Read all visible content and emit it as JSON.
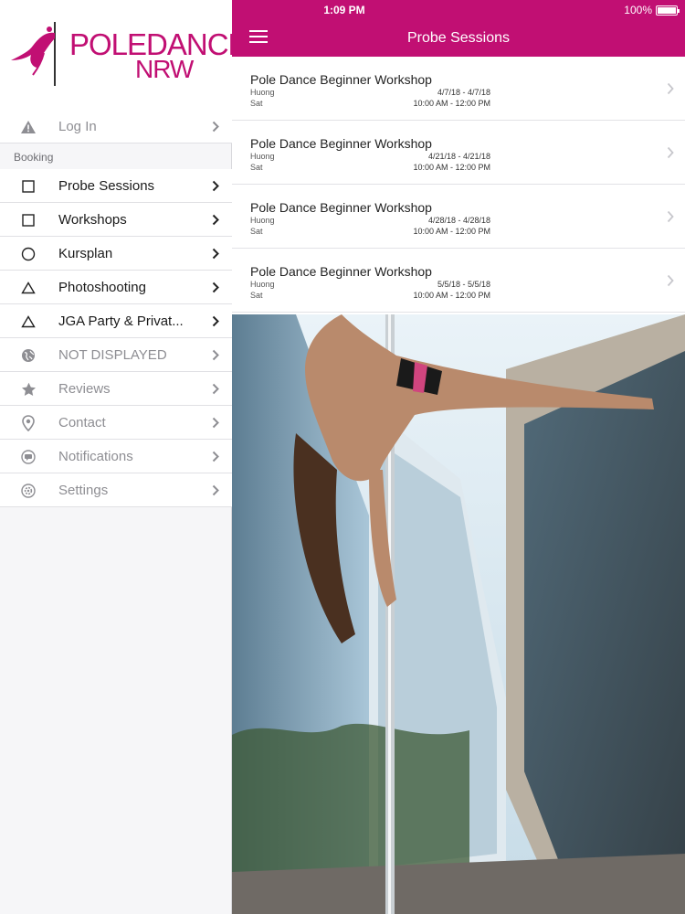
{
  "status_bar": {
    "time": "1:09 PM",
    "battery": "100%"
  },
  "header": {
    "title": "Probe Sessions"
  },
  "logo": {
    "line1": "POLEDANCE",
    "line2": "NRW"
  },
  "sidebar": {
    "section_booking": "Booking",
    "items": [
      {
        "label": "Log In",
        "icon": "warning-icon",
        "muted": true
      },
      {
        "label": "Probe Sessions",
        "icon": "square-icon",
        "muted": false
      },
      {
        "label": "Workshops",
        "icon": "square-icon",
        "muted": false
      },
      {
        "label": "Kursplan",
        "icon": "circle-icon",
        "muted": false
      },
      {
        "label": "Photoshooting",
        "icon": "triangle-icon",
        "muted": false
      },
      {
        "label": "JGA Party & Privat...",
        "icon": "triangle-icon",
        "muted": false
      },
      {
        "label": "NOT DISPLAYED",
        "icon": "globe-icon",
        "muted": true
      },
      {
        "label": "Reviews",
        "icon": "star-icon",
        "muted": true
      },
      {
        "label": "Contact",
        "icon": "location-pin-icon",
        "muted": true
      },
      {
        "label": "Notifications",
        "icon": "chat-bubble-icon",
        "muted": true
      },
      {
        "label": "Settings",
        "icon": "gear-icon",
        "muted": true
      }
    ]
  },
  "sessions": [
    {
      "title": "Pole Dance Beginner Workshop",
      "teacher": "Huong",
      "day": "Sat",
      "dates": "4/7/18 - 4/7/18",
      "time": "10:00 AM - 12:00 PM"
    },
    {
      "title": "Pole Dance Beginner Workshop",
      "teacher": "Huong",
      "day": "Sat",
      "dates": "4/21/18 - 4/21/18",
      "time": "10:00 AM - 12:00 PM"
    },
    {
      "title": "Pole Dance Beginner Workshop",
      "teacher": "Huong",
      "day": "Sat",
      "dates": "4/28/18 - 4/28/18",
      "time": "10:00 AM - 12:00 PM"
    },
    {
      "title": "Pole Dance Beginner Workshop",
      "teacher": "Huong",
      "day": "Sat",
      "dates": "5/5/18 - 5/5/18",
      "time": "10:00 AM - 12:00 PM"
    }
  ],
  "colors": {
    "brand": "#c10f73",
    "sidebar_bg": "#f6f6f8"
  }
}
